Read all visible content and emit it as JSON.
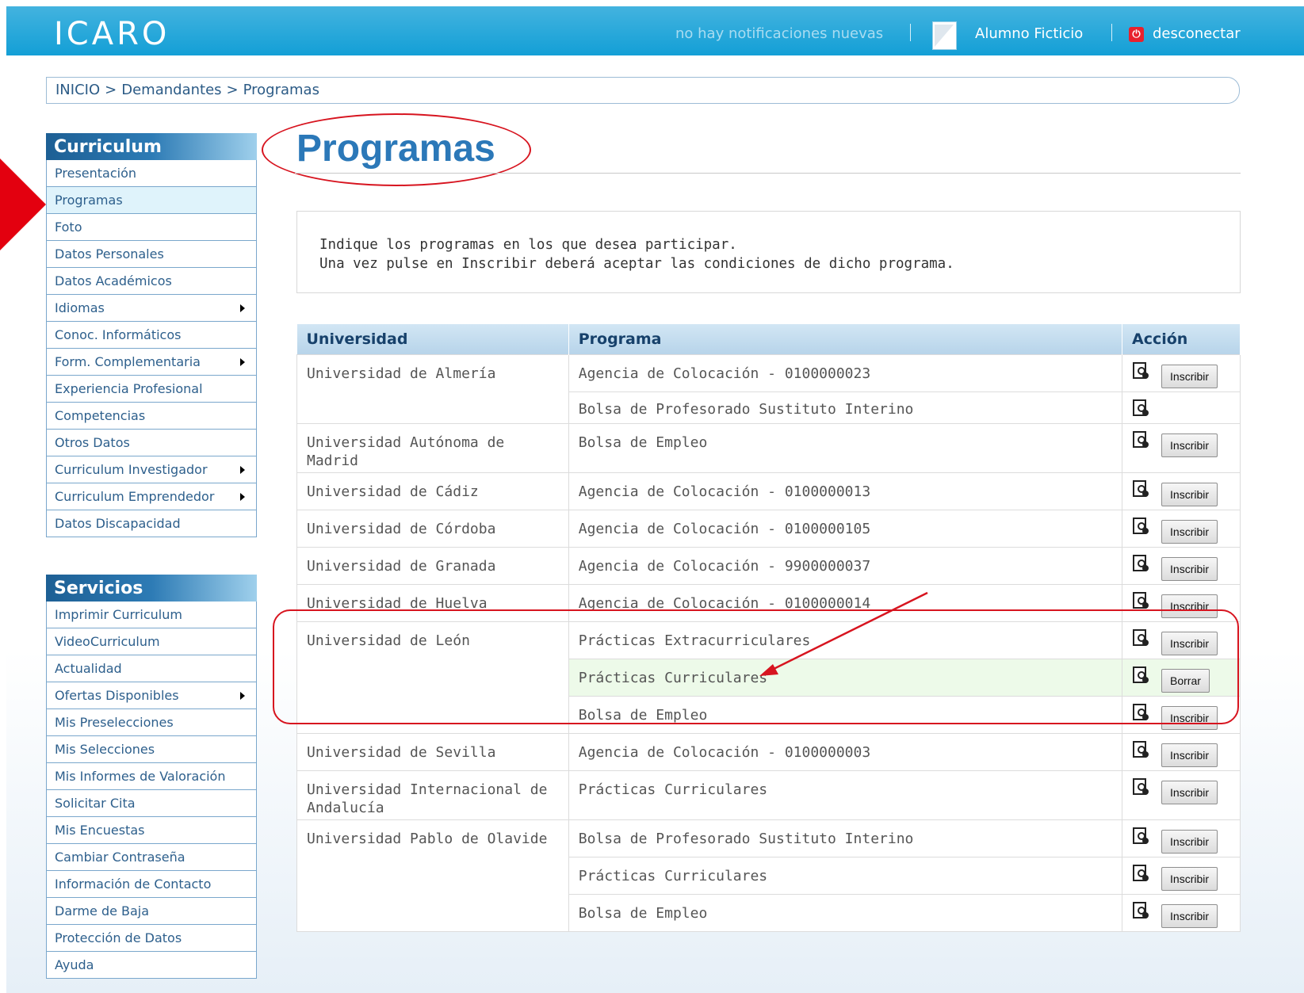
{
  "app": {
    "logo": "ICARO"
  },
  "header": {
    "notifications": "no hay notificaciones nuevas",
    "user": "Alumno Ficticio",
    "logout": "desconectar"
  },
  "breadcrumb": {
    "items": [
      "INICIO",
      "Demandantes",
      "Programas"
    ],
    "separator": ">"
  },
  "sidebar": {
    "curriculum": {
      "title": "Curriculum",
      "items": [
        {
          "label": "Presentación"
        },
        {
          "label": "Programas"
        },
        {
          "label": "Foto"
        },
        {
          "label": "Datos Personales"
        },
        {
          "label": "Datos Académicos"
        },
        {
          "label": "Idiomas"
        },
        {
          "label": "Conoc. Informáticos"
        },
        {
          "label": "Form. Complementaria"
        },
        {
          "label": "Experiencia Profesional"
        },
        {
          "label": "Competencias"
        },
        {
          "label": "Otros Datos"
        },
        {
          "label": "Curriculum Investigador"
        },
        {
          "label": "Curriculum Emprendedor"
        },
        {
          "label": "Datos Discapacidad"
        }
      ]
    },
    "servicios": {
      "title": "Servicios",
      "items": [
        {
          "label": "Imprimir Curriculum"
        },
        {
          "label": "VideoCurriculum"
        },
        {
          "label": "Actualidad"
        },
        {
          "label": "Ofertas Disponibles"
        },
        {
          "label": "Mis Preselecciones"
        },
        {
          "label": "Mis Selecciones"
        },
        {
          "label": "Mis Informes de Valoración"
        },
        {
          "label": "Solicitar Cita"
        },
        {
          "label": "Mis Encuestas"
        },
        {
          "label": "Cambiar Contraseña"
        },
        {
          "label": "Información de Contacto"
        },
        {
          "label": "Darme de Baja"
        },
        {
          "label": "Protección de Datos"
        },
        {
          "label": "Ayuda"
        }
      ]
    }
  },
  "main": {
    "title": "Programas",
    "info_line1": "Indique los programas en los que desea participar.",
    "info_line2": "Una vez pulse en Inscribir deberá aceptar las condiciones de dicho programa.",
    "table": {
      "headers": [
        "Universidad",
        "Programa",
        "Acción"
      ],
      "rows": [
        {
          "universidad": "Universidad de Almería",
          "programa": "Agencia de Colocación - 0100000023",
          "accion": "Inscribir"
        },
        {
          "universidad": "",
          "programa": "Bolsa de Profesorado Sustituto Interino",
          "accion": ""
        },
        {
          "universidad": "Universidad Autónoma de Madrid",
          "programa": "Bolsa de Empleo",
          "accion": "Inscribir"
        },
        {
          "universidad": "Universidad de Cádiz",
          "programa": "Agencia de Colocación - 0100000013",
          "accion": "Inscribir"
        },
        {
          "universidad": "Universidad de Córdoba",
          "programa": "Agencia de Colocación - 0100000105",
          "accion": "Inscribir"
        },
        {
          "universidad": "Universidad de Granada",
          "programa": "Agencia de Colocación - 9900000037",
          "accion": "Inscribir"
        },
        {
          "universidad": "Universidad de Huelva",
          "programa": "Agencia de Colocación - 0100000014",
          "accion": "Inscribir"
        },
        {
          "universidad": "Universidad de León",
          "programa": "Prácticas Extracurriculares",
          "accion": "Inscribir"
        },
        {
          "universidad": "",
          "programa": "Prácticas Curriculares",
          "accion": "Borrar"
        },
        {
          "universidad": "",
          "programa": "Bolsa de Empleo",
          "accion": "Inscribir"
        },
        {
          "universidad": "Universidad de Sevilla",
          "programa": "Agencia de Colocación - 0100000003",
          "accion": "Inscribir"
        },
        {
          "universidad": "Universidad Internacional de Andalucía",
          "programa": "Prácticas Curriculares",
          "accion": "Inscribir"
        },
        {
          "universidad": "Universidad Pablo de Olavide",
          "programa": "Bolsa de Profesorado Sustituto Interino",
          "accion": "Inscribir"
        },
        {
          "universidad": "",
          "programa": "Prácticas Curriculares",
          "accion": "Inscribir"
        },
        {
          "universidad": "",
          "programa": "Bolsa de Empleo",
          "accion": "Inscribir"
        }
      ]
    }
  },
  "icons": {
    "view": "document-magnifier-icon",
    "logout": "power-icon",
    "submenu": "caret-right-icon"
  },
  "colors": {
    "header": "#139fd6",
    "accent": "#2b78b8",
    "annotation": "#d7141f",
    "selected_row": "#edfae9"
  }
}
